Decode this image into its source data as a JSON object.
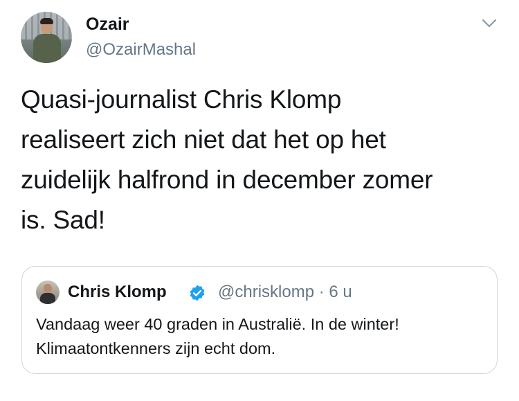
{
  "tweet": {
    "author_name": "Ozair",
    "author_handle": "@OzairMashal",
    "text_lines": [
      "Quasi-journalist Chris Klomp",
      "realiseert zich niet dat het op het",
      "zuidelijk halfrond in december zomer",
      "is. Sad!"
    ]
  },
  "quoted_tweet": {
    "author_name": "Chris Klomp",
    "author_handle_time": "@chrisklomp · 6 u",
    "verified": true,
    "text_lines": [
      "Vandaag weer 40 graden in Australië. In de winter!",
      "Klimaatontkenners zijn echt dom."
    ]
  },
  "icons": {
    "menu": "chevron-down-icon",
    "verified": "verified-badge-icon"
  },
  "colors": {
    "text": "#14171a",
    "secondary": "#657786",
    "border": "#ccd6dd",
    "verified": "#1da1f2"
  }
}
